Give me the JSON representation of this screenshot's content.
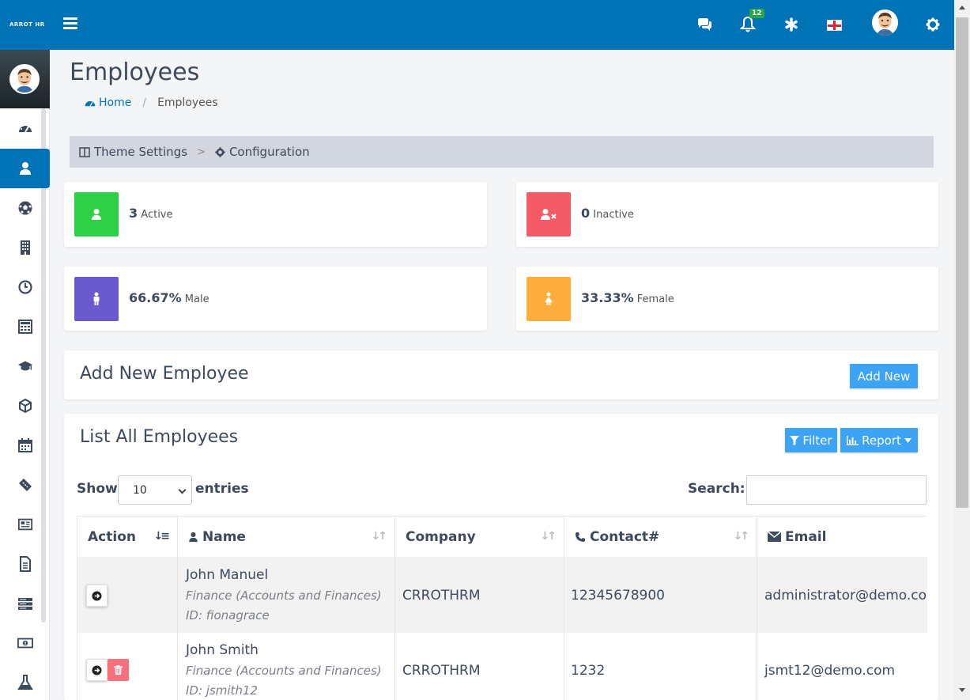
{
  "topbar": {
    "logo_prefix": "",
    "logo_accent": "",
    "logo_rest": "ARROT HR",
    "notification_count": "12",
    "icons": [
      "chat-icon",
      "bell-icon",
      "asterisk-icon",
      "flag-icon",
      "user-avatar",
      "gear-icon"
    ],
    "brand_color": "#0073b7"
  },
  "sidebar": {
    "items": [
      "dashboard-icon",
      "user-icon",
      "soccer-ball-icon",
      "building-icon",
      "clock-icon",
      "calculator-icon",
      "graduation-cap-icon",
      "cube-icon",
      "calendar-icon",
      "ticket-icon",
      "newspaper-icon",
      "document-icon",
      "server-icon",
      "money-icon",
      "flask-icon"
    ],
    "active_index": 1
  },
  "page": {
    "title": "Employees",
    "breadcrumb_home": "Home",
    "breadcrumb_current": "Employees"
  },
  "theme_bar": {
    "theme_settings": "Theme Settings",
    "configuration": "Configuration"
  },
  "stats": {
    "active_count": "3",
    "active_label": "Active",
    "inactive_count": "0",
    "inactive_label": "Inactive",
    "male_value": "66.67%",
    "male_label": "Male",
    "female_value": "33.33%",
    "female_label": "Female",
    "colors": {
      "active": "#2fd045",
      "inactive": "#f55b66",
      "male": "#6a5acd",
      "female": "#ffad3c"
    }
  },
  "add_section": {
    "title": "Add New Employee",
    "button": "Add New"
  },
  "list_section": {
    "title": "List All Employees",
    "filter_button": "Filter",
    "report_button": "Report",
    "show_label": "Show",
    "page_size": "10",
    "entries_label": "entries",
    "search_label": "Search:"
  },
  "table": {
    "headers": [
      "Action",
      "Name",
      "Company",
      "Contact#",
      "Email"
    ],
    "rows": [
      {
        "name": "John Manuel",
        "department": "Finance (Accounts and Finances)",
        "id": "ID: fionagrace",
        "company": "CRROTHRM",
        "contact": "12345678900",
        "email": "administrator@demo.com"
      },
      {
        "name": "John Smith",
        "department": "Finance (Accounts and Finances)",
        "id": "ID: jsmith12",
        "company": "CRROTHRM",
        "contact": "1232",
        "email": "jsmt12@demo.com"
      }
    ]
  }
}
